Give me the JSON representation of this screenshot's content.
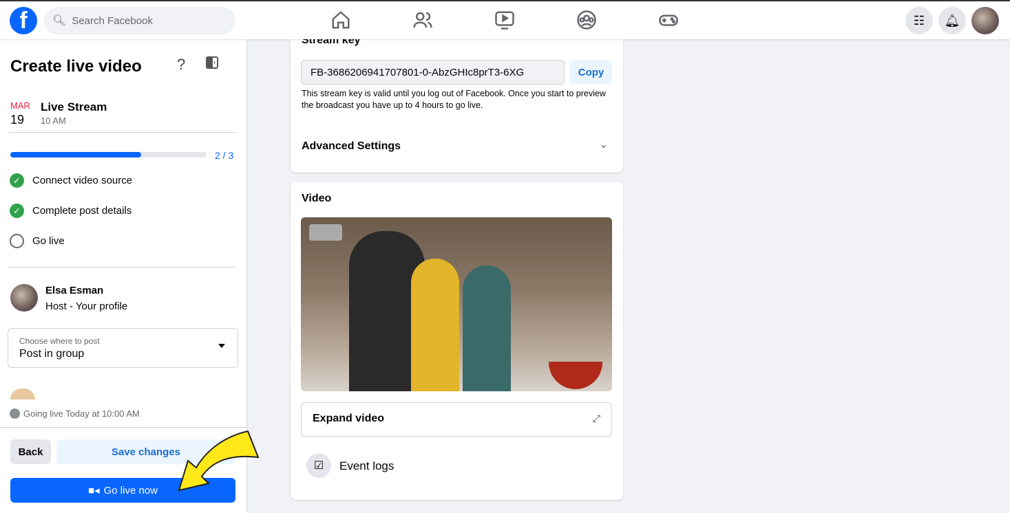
{
  "topbar": {
    "search_placeholder": "Search Facebook",
    "nav": [
      "home-icon",
      "friends-icon",
      "watch-icon",
      "groups-icon",
      "gaming-icon"
    ],
    "right": [
      "menu-grid-icon",
      "notifications-icon",
      "profile-avatar"
    ]
  },
  "sidebar": {
    "title": "Create live video",
    "event": {
      "month": "MAR",
      "day": "19",
      "name": "Live Stream",
      "time": "10 AM"
    },
    "progress": {
      "label": "2 / 3",
      "fraction": 0.667
    },
    "steps": [
      {
        "label": "Connect video source",
        "done": true
      },
      {
        "label": "Complete post details",
        "done": true
      },
      {
        "label": "Go live",
        "done": false
      }
    ],
    "host": {
      "name": "Elsa Esman",
      "role": "Host - Your profile"
    },
    "post_where": {
      "label": "Choose where to post",
      "value": "Post in group"
    },
    "schedule": "Going live Today at 10:00 AM",
    "back": "Back",
    "save": "Save changes",
    "go_live": "Go live now"
  },
  "main": {
    "stream_key_title": "Stream key",
    "stream_key": "FB-3686206941707801-0-AbzGHIc8prT3-6XG",
    "copy": "Copy",
    "stream_key_note": "This stream key is valid until you log out of Facebook. Once you start to preview the broadcast you have up to 4 hours to go live.",
    "advanced": "Advanced Settings",
    "video_title": "Video",
    "expand": "Expand video",
    "event_logs": "Event logs"
  },
  "colors": {
    "accent": "#0866ff",
    "success": "#31a24c",
    "date_red": "#e41e3f",
    "arrow": "#ffe819"
  }
}
